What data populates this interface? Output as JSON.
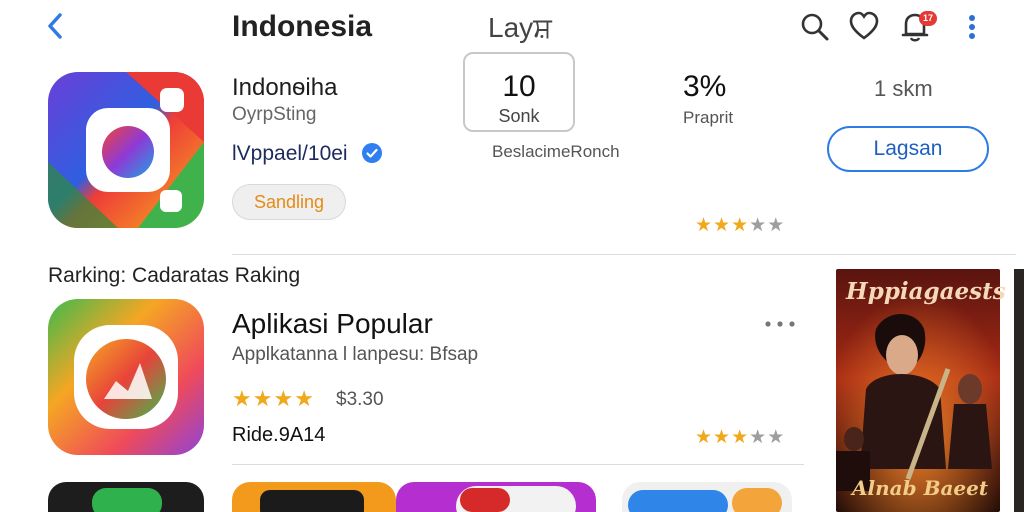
{
  "header": {
    "title": "Indonesia",
    "subtitle": "Layਸ਼",
    "notification_count": "17"
  },
  "app_card": {
    "name": "Indonѳiha",
    "developer": "OyrpSting",
    "meta": "lVppael/10ei",
    "chip": "Sandling",
    "stat_box_value": "10",
    "stat_box_label": "Sonk",
    "stat_caption": "BeslacimeRonch",
    "stat2_value": "3%",
    "stat2_label": "Praprit",
    "stat3_value": "1 skm",
    "install_label": "Lagsan",
    "rating": 3
  },
  "ranking": {
    "label": "Rarking: Cadaratas Raking"
  },
  "app_list_item": {
    "title": "Aplikasi Popular",
    "subtitle": "Applkatanna l lanpesu: Bfsap",
    "price": "$3.30",
    "extra": "Ride.9A14",
    "rating": 3,
    "inline_stars": 4
  },
  "poster": {
    "title": "Hppiagaests",
    "subtitle": "Alnab Baeet"
  },
  "colors": {
    "accent": "#2d7be5",
    "star": "#f0a81c",
    "star_off": "#9e9e9e",
    "badge": "#e53935"
  },
  "icons": [
    "back-icon",
    "search-icon",
    "heart-icon",
    "bell-icon",
    "more-vert-icon",
    "verified-icon",
    "more-horiz-icon"
  ]
}
